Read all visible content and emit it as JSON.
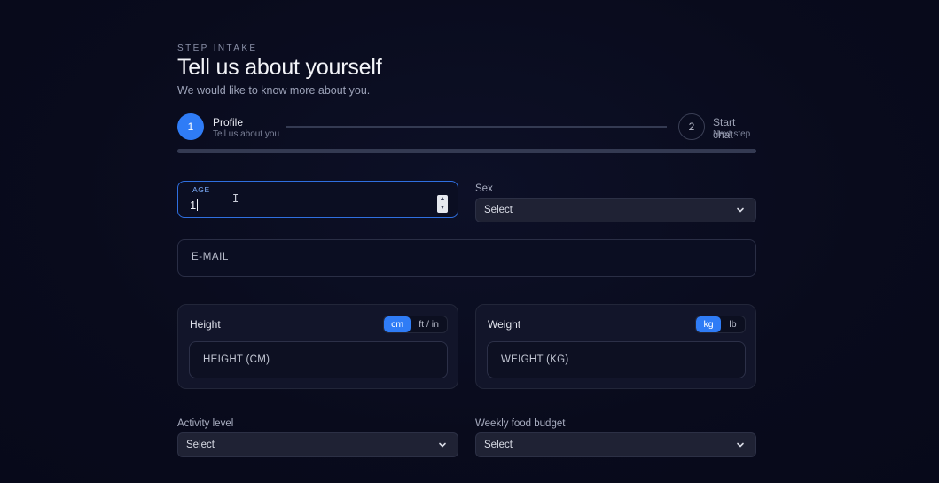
{
  "header": {
    "eyebrow": "STEP INTAKE",
    "title": "Tell us about yourself",
    "subtitle": "We would like to know more about you."
  },
  "stepper": {
    "steps": [
      {
        "number": "1",
        "title": "Profile",
        "subtitle": "Tell us about you",
        "active": true
      },
      {
        "number": "2",
        "title": "Start chat",
        "subtitle": "Next step",
        "active": false
      }
    ],
    "accent_color": "#2f7cf6"
  },
  "form": {
    "age": {
      "label": "AGE",
      "value": "1"
    },
    "sex": {
      "label": "Sex",
      "selected": "Select"
    },
    "email": {
      "placeholder": "E-MAIL"
    },
    "height": {
      "title": "Height",
      "units": [
        "cm",
        "ft / in"
      ],
      "active_unit": "cm",
      "placeholder": "HEIGHT (CM)"
    },
    "weight": {
      "title": "Weight",
      "units": [
        "kg",
        "lb"
      ],
      "active_unit": "kg",
      "placeholder": "WEIGHT (KG)"
    },
    "activity": {
      "label": "Activity level",
      "selected": "Select"
    },
    "budget": {
      "label": "Weekly food budget",
      "selected": "Select"
    }
  },
  "icons": [
    "chevron-down-icon",
    "spinner-up-icon",
    "spinner-down-icon",
    "text-cursor-icon"
  ]
}
